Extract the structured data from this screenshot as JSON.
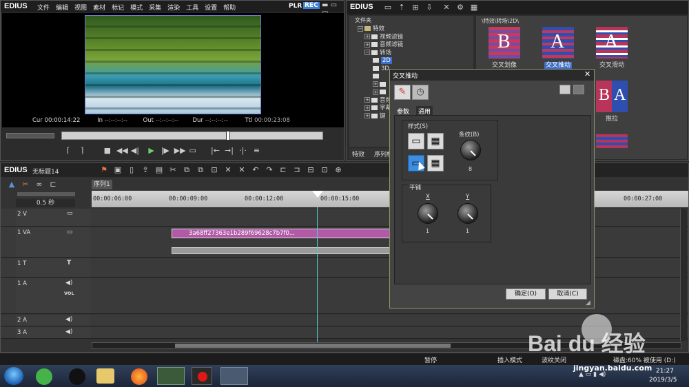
{
  "player": {
    "brand": "EDIUS",
    "menu": [
      "文件",
      "编辑",
      "视图",
      "素材",
      "标记",
      "模式",
      "采集",
      "渲染",
      "工具",
      "设置",
      "帮助"
    ],
    "plr": "PLR",
    "rec": "REC",
    "cur_label": "Cur",
    "cur": "00:00:14:22",
    "in_label": "In",
    "in": "--:--:--:--",
    "out_label": "Out",
    "out": "--:--:--:--",
    "dur_label": "Dur",
    "dur": "--:--:--:--",
    "ttl_label": "Ttl",
    "ttl": "00:00:23:08"
  },
  "effects": {
    "brand": "EDIUS",
    "tree_header": "文件夹",
    "path": "\\特效\\转场\\2D\\",
    "tree": [
      {
        "label": "特效",
        "indent": 0
      },
      {
        "label": "视频滤镜",
        "indent": 1
      },
      {
        "label": "音频滤镜",
        "indent": 1
      },
      {
        "label": "转场",
        "indent": 1
      },
      {
        "label": "2D",
        "indent": 2
      },
      {
        "label": "3D",
        "indent": 2
      },
      {
        "label": "",
        "indent": 2
      },
      {
        "label": "",
        "indent": 2
      },
      {
        "label": "",
        "indent": 2
      },
      {
        "label": "音频",
        "indent": 1
      },
      {
        "label": "字幕",
        "indent": 1
      },
      {
        "label": "键",
        "indent": 1
      }
    ],
    "tabs": [
      "特效",
      "序列标"
    ],
    "items": [
      {
        "label": "交叉划像",
        "letter": "B",
        "selected": false
      },
      {
        "label": "交叉推动",
        "letter": "A",
        "selected": true
      },
      {
        "label": "交叉滑动",
        "letter": "A",
        "selected": false
      },
      {
        "label": "",
        "letter": "",
        "selected": false
      },
      {
        "label": "推拉",
        "letter": "BA",
        "selected": false
      }
    ]
  },
  "timeline": {
    "brand": "EDIUS",
    "project": "无标题14",
    "sequence_tab": "序列1",
    "zoom": "0.5 秒",
    "ruler": [
      "00:00:06:00",
      "00:00:09:00",
      "00:00:12:00",
      "00:00:15:00",
      "00:00:27:00"
    ],
    "tracks": [
      {
        "name": "2 V"
      },
      {
        "name": "1 VA"
      },
      {
        "name": "1 T",
        "icon": "T"
      },
      {
        "name": "1 A",
        "vol": "VOL"
      },
      {
        "name": "2 A"
      },
      {
        "name": "3 A"
      }
    ],
    "clip_name": "3a68ff27363e1b289f69628c7b7f0..."
  },
  "dialog": {
    "title": "交叉推动",
    "tabs": [
      "参数",
      "通用"
    ],
    "style_group": "样式(S)",
    "stripes_label": "条纹(B)",
    "stripes_value": "8",
    "tile_group": "平铺",
    "x_label": "X",
    "x_value": "1",
    "y_label": "Y",
    "y_value": "1",
    "ok": "确定(O)",
    "cancel": "取消(C)"
  },
  "status": {
    "stop": "暂停",
    "insert_mode": "插入模式",
    "ripple": "波纹关闭",
    "disk": "磁盘:60% 被使用 (D:)"
  },
  "taskbar": {
    "time": "21:27",
    "date": "2019/3/5"
  },
  "watermark": {
    "brand": "Bai du 经验",
    "url": "jingyan.baidu.com"
  }
}
